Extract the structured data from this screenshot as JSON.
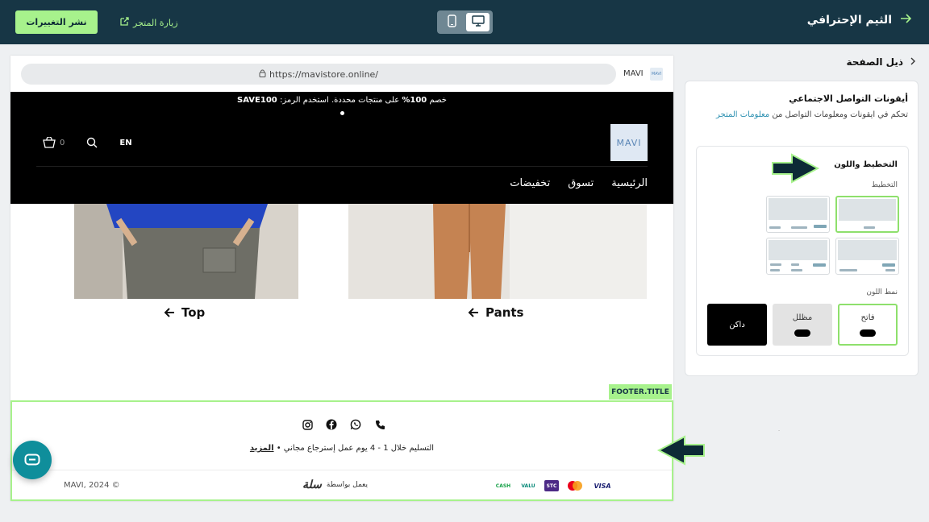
{
  "topbar": {
    "publish_label": "نشر التغييرات",
    "visit_label": "زيارة المتجر",
    "theme_title": "الثيم الإحترافي",
    "devices": {
      "mobile": "mobile-icon",
      "desktop": "desktop-icon",
      "selected": "desktop"
    }
  },
  "sidebar": {
    "breadcrumb": "ذيل الصفحة",
    "section_title": "أيقونات التواصل الاجتماعي",
    "section_desc": "تحكم في ايقونات ومعلومات التواصل من",
    "section_link": "معلومات المتجر",
    "card_title": "التخطيط واللون",
    "layout_label": "التخطيط",
    "color_label": "نمط اللون",
    "color_options": [
      {
        "label": "فاتح",
        "selected": true
      },
      {
        "label": "مظلل",
        "selected": false
      },
      {
        "label": "داكن",
        "selected": false
      }
    ],
    "page_marker": "-"
  },
  "preview": {
    "url": "https://mavistore.online/",
    "site_name": "MAVI",
    "favicon_text": "MAVI",
    "promo_pre": "خصم ",
    "promo_pct": "100%",
    "promo_post": " على منتجات محددة. استخدم الرمز: ",
    "promo_code": "SAVE100",
    "logo_text": "MAVI",
    "lang": "EN",
    "cart_count": "0",
    "nav": [
      "الرئيسية",
      "تسوق",
      "تخفيضات"
    ],
    "products": [
      {
        "label": "Pants"
      },
      {
        "label": "Top"
      }
    ],
    "footer_tag": "FOOTER.TITLE",
    "delivery_text": "التسليم خلال 1 - 4 يوم عمل إسترجاع مجاني • ",
    "delivery_more": "المزيد",
    "copyright": "MAVI, 2024 ©",
    "powered_by": "يعمل بواسطة",
    "salla": "سلة",
    "payments": [
      "VISA",
      "mastercard",
      "STC",
      "VALU",
      "CASH"
    ]
  },
  "colors": {
    "accent": "#a7f28c",
    "topbar": "#173645",
    "chat": "#0f8e9b"
  }
}
